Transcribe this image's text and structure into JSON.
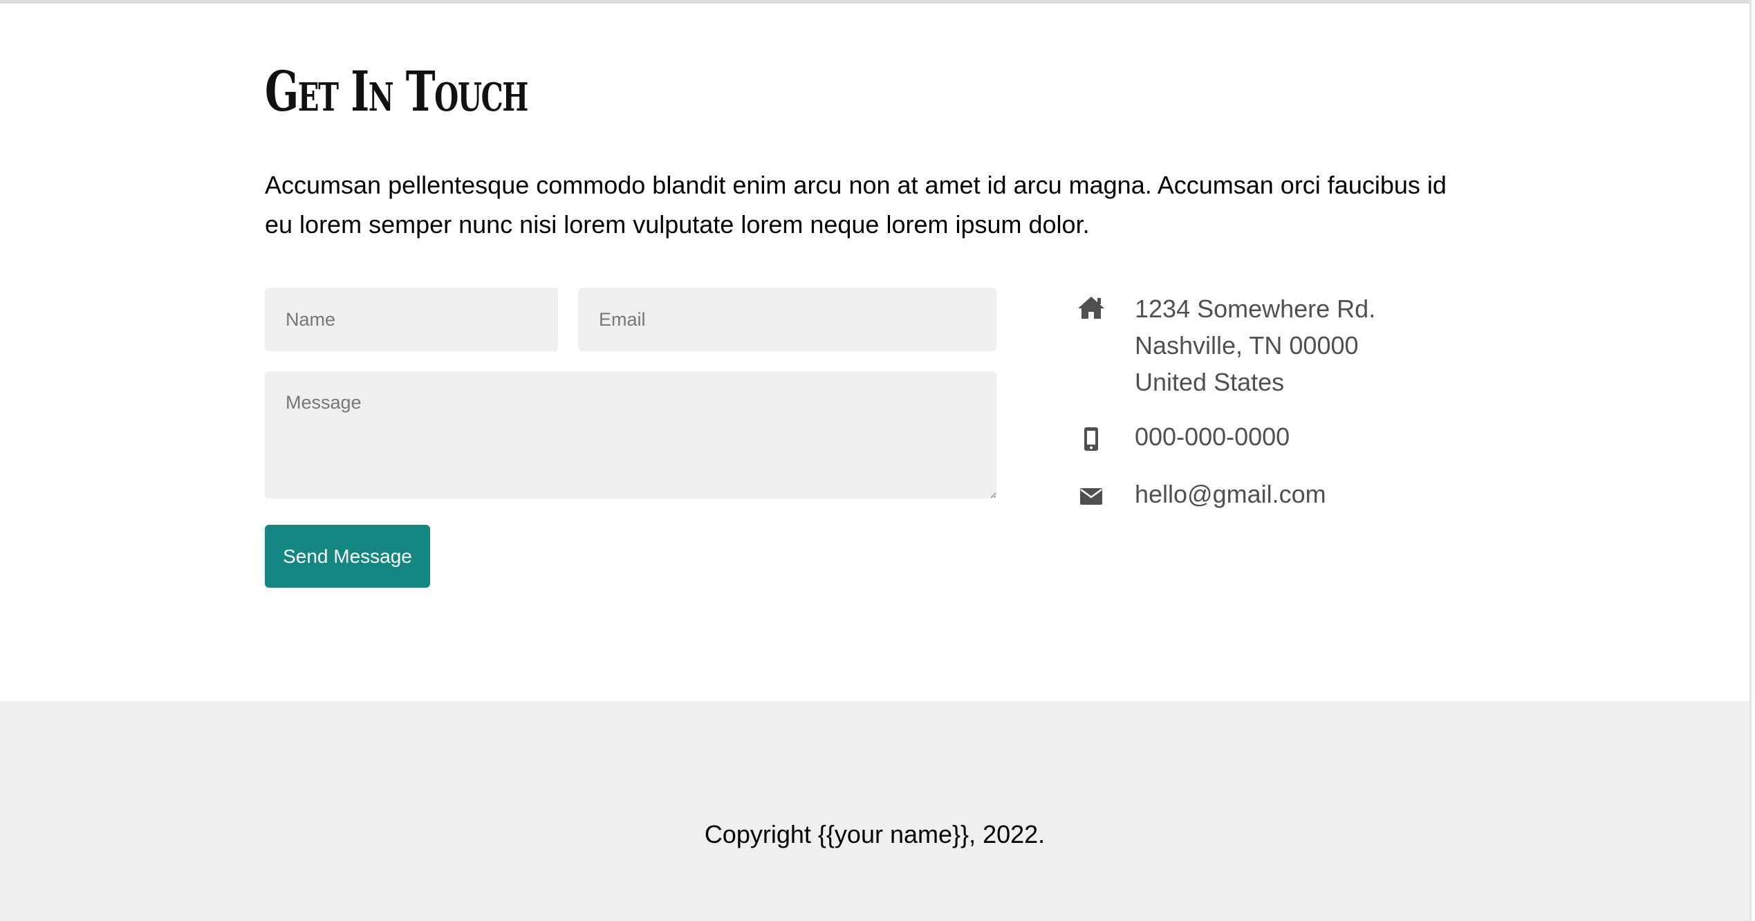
{
  "contact": {
    "title": "Get In Touch",
    "intro": "Accumsan pellentesque commodo blandit enim arcu non at amet id arcu magna. Accumsan orci faucibus id eu lorem semper nunc nisi lorem vulputate lorem neque lorem ipsum dolor.",
    "form": {
      "name_placeholder": "Name",
      "email_placeholder": "Email",
      "message_placeholder": "Message",
      "submit_label": "Send Message"
    },
    "info": {
      "address_icon": "home-icon",
      "address_lines": [
        "1234 Somewhere Rd.",
        "Nashville, TN 00000",
        "United States"
      ],
      "phone_icon": "mobile-phone-icon",
      "phone": "000-000-0000",
      "email_icon": "envelope-icon",
      "email": "hello@gmail.com"
    }
  },
  "footer": {
    "copyright": "Copyright {{your name}}, 2022."
  },
  "colors": {
    "accent": "#148782",
    "field_background": "#efefef",
    "footer_background": "#efefef",
    "info_text": "#505050"
  }
}
